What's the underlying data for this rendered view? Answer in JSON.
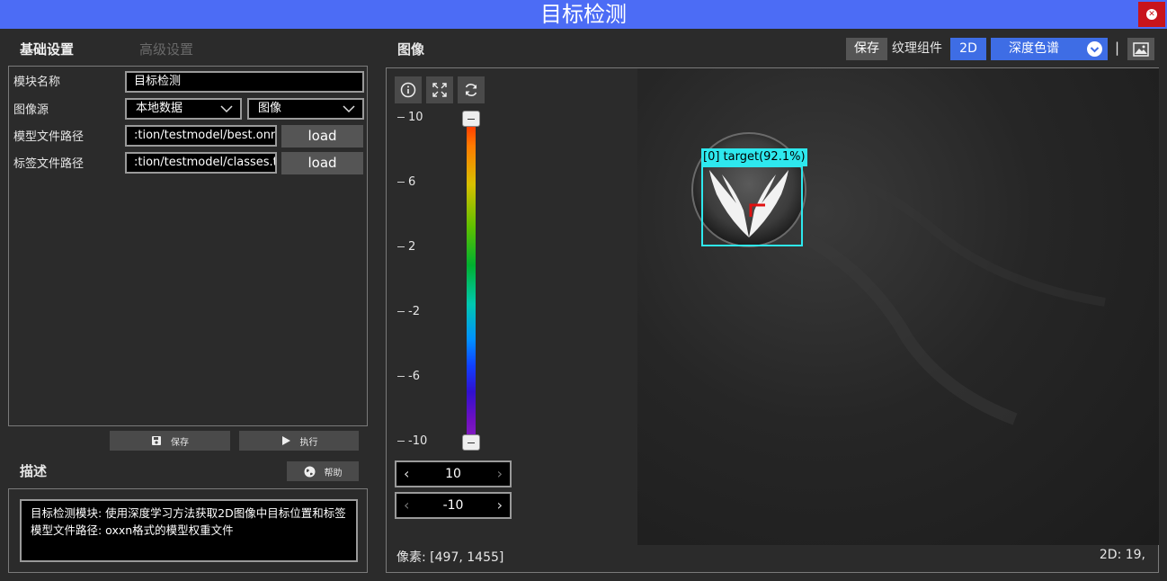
{
  "window": {
    "title": "目标检测"
  },
  "tabs": {
    "basic": "基础设置",
    "advanced": "高级设置"
  },
  "params": {
    "module_name_label": "模块名称",
    "module_name_value": "目标检测",
    "image_source_label": "图像源",
    "image_source_value": "本地数据",
    "image_source_type": "图像",
    "model_path_label": "模型文件路径",
    "model_path_value": ":tion/testmodel/best.onnx",
    "label_path_label": "标签文件路径",
    "label_path_value": ":tion/testmodel/classes.txt",
    "load_label": "load"
  },
  "actions": {
    "save": "保存",
    "execute": "执行",
    "help": "帮助"
  },
  "description": {
    "title": "描述",
    "text_line1": "目标检测模块: 使用深度学习方法获取2D图像中目标位置和标签",
    "text_line2": "模型文件路径: oxxn格式的模型权重文件"
  },
  "image_panel": {
    "title": "图像",
    "save": "保存",
    "texture_component": "纹理组件",
    "mode_2d": "2D",
    "colormap": "深度色谱",
    "separator": "|"
  },
  "colorbar": {
    "ticks": [
      "10",
      "6",
      "2",
      "-2",
      "-6",
      "-10"
    ],
    "upper_value": "10",
    "lower_value": "-10"
  },
  "detection": {
    "label": "[0] target(92.1%)",
    "confidence": 92.1
  },
  "status": {
    "pixel": "像素: [497, 1455]",
    "value_2d": "2D: 19,"
  },
  "colors": {
    "accent": "#4c6cf5",
    "close": "#c8141c",
    "bbox": "#2ee8ee"
  },
  "icons": [
    "close-icon",
    "save-icon",
    "play-icon",
    "globe-icon",
    "info-icon",
    "fullscreen-icon",
    "refresh-icon",
    "image-icon",
    "chevron-down-icon"
  ]
}
